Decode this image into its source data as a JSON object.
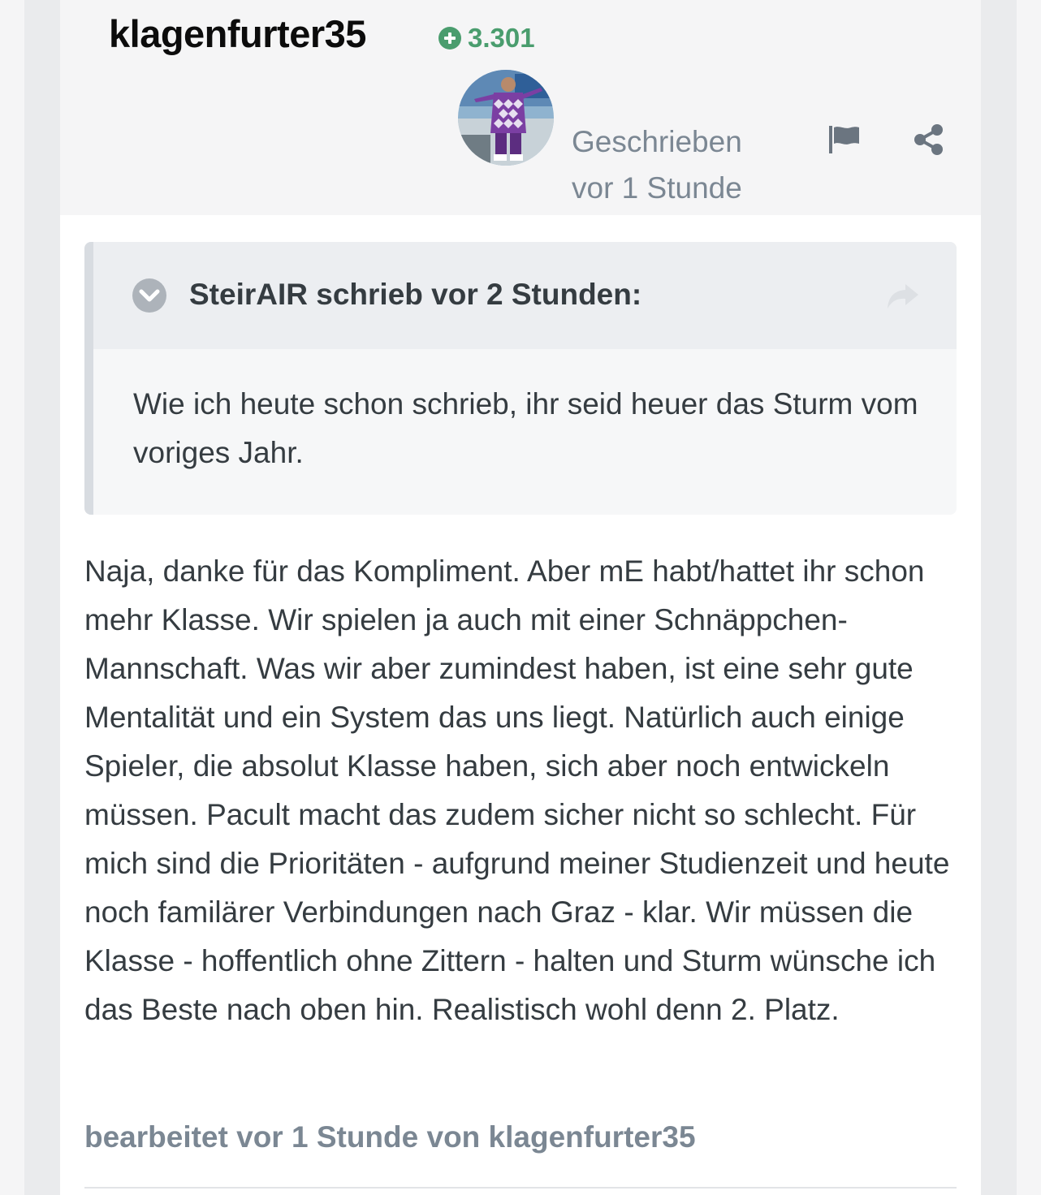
{
  "post": {
    "author": "klagenfurter35",
    "reputation": "3.301",
    "posted_label": "Geschrieben",
    "posted_time": "vor 1 Stunde",
    "quote": {
      "header": "SteirAIR schrieb vor 2 Stunden:",
      "text": "Wie ich heute schon schrieb, ihr seid heuer das Sturm vom voriges Jahr."
    },
    "body": "Naja, danke für das Kompliment. Aber mE habt/hattet ihr schon mehr Klasse. Wir spielen ja auch mit einer Schnäppchen-Mannschaft. Was wir aber zumindest haben, ist eine sehr gute Mentalität und ein System das uns liegt. Natürlich auch einige Spieler, die absolut Klasse haben, sich aber noch entwickeln müssen. Pacult macht das zudem sicher nicht so schlecht. Für mich sind die Prioritäten - aufgrund meiner Studienzeit und heute noch familärer  Verbindungen nach Graz - klar. Wir müssen die Klasse - hoffentlich ohne Zittern - halten und Sturm wünsche ich das Beste nach oben hin. Realistisch wohl denn 2. Platz.",
    "edited": "bearbeitet vor 1 Stunde von klagenfurter35"
  },
  "icons": {
    "reputation": "plus-circle-icon",
    "report": "flag-icon",
    "share": "share-icon",
    "quote_toggle": "chevron-down-circle-icon",
    "quote_link": "share-arrow-icon"
  },
  "colors": {
    "reputation": "#4a9d6e",
    "meta_text": "#7b8793",
    "quote_bar": "#d8dce1"
  }
}
